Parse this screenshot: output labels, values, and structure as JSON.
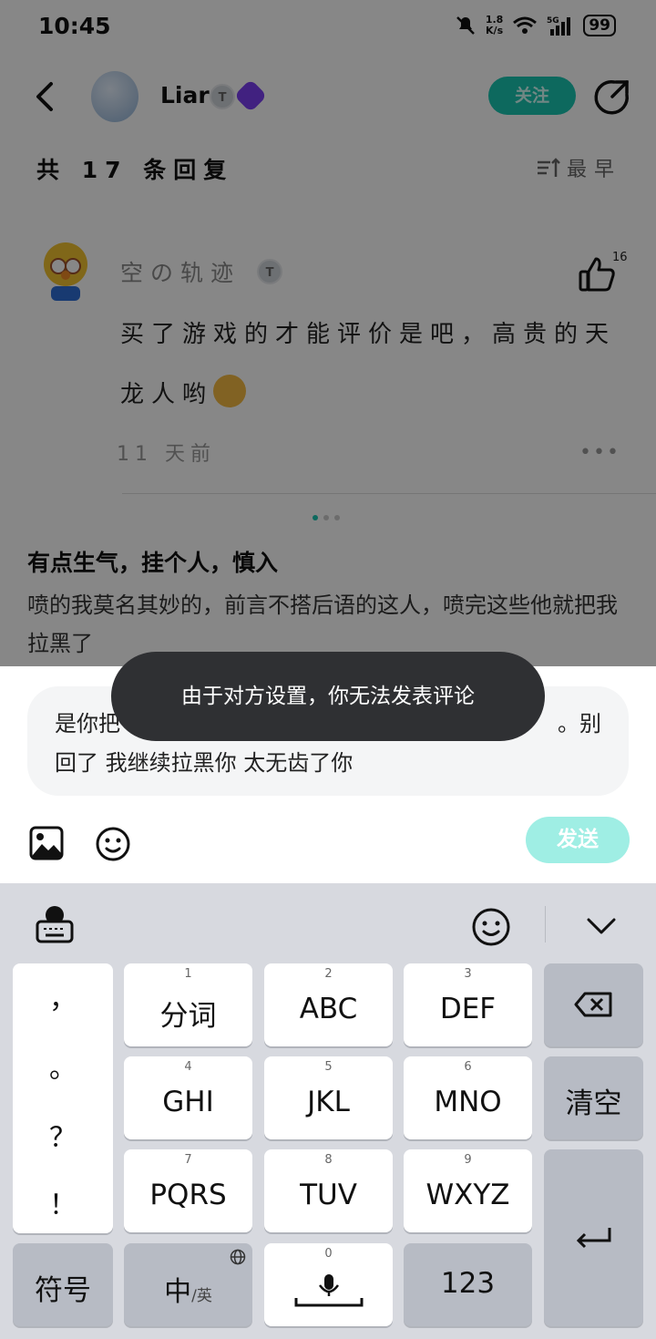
{
  "status_bar": {
    "time": "10:45",
    "net_speed_value": "1.8",
    "net_speed_unit": "K/s",
    "network": "5G",
    "battery": "99"
  },
  "header": {
    "author": "Liar",
    "author_level": "T",
    "follow_label": "关注"
  },
  "replies": {
    "count_label": "共 17 条回复",
    "sort_label": "最早"
  },
  "comment": {
    "user": "空の轨迹",
    "user_level": "T",
    "likes": "16",
    "text": "买了游戏的才能评价是吧，高贵的天龙人哟",
    "time": "11 天前"
  },
  "post": {
    "title": "有点生气，挂个人，慎入",
    "body": "喷的我莫名其妙的，前言不搭后语的这人，喷完这些他就把我拉黑了"
  },
  "reply_input": {
    "text_line1": "是你把",
    "text_line1_end": "。别",
    "text_line2": "回了 我继续拉黑你 太无齿了你"
  },
  "toast": "由于对方设置，你无法发表评论",
  "composer": {
    "send_label": "发送"
  },
  "keyboard": {
    "punctuation": [
      "，",
      "。",
      "？",
      "！"
    ],
    "keys": [
      {
        "num": "1",
        "label": "分词"
      },
      {
        "num": "2",
        "label": "ABC"
      },
      {
        "num": "3",
        "label": "DEF"
      },
      {
        "num": "4",
        "label": "GHI"
      },
      {
        "num": "5",
        "label": "JKL"
      },
      {
        "num": "6",
        "label": "MNO"
      },
      {
        "num": "7",
        "label": "PQRS"
      },
      {
        "num": "8",
        "label": "TUV"
      },
      {
        "num": "9",
        "label": "WXYZ"
      }
    ],
    "clear_label": "清空",
    "symbols_label": "符号",
    "lang_label": "中",
    "lang_sub": "/英",
    "space_num": "0",
    "numbers_label": "123"
  },
  "colors": {
    "accent": "#19c6b2",
    "send_disabled": "#9feee4",
    "toast_bg": "#2f3033",
    "keyboard_bg": "#d7d9df"
  }
}
